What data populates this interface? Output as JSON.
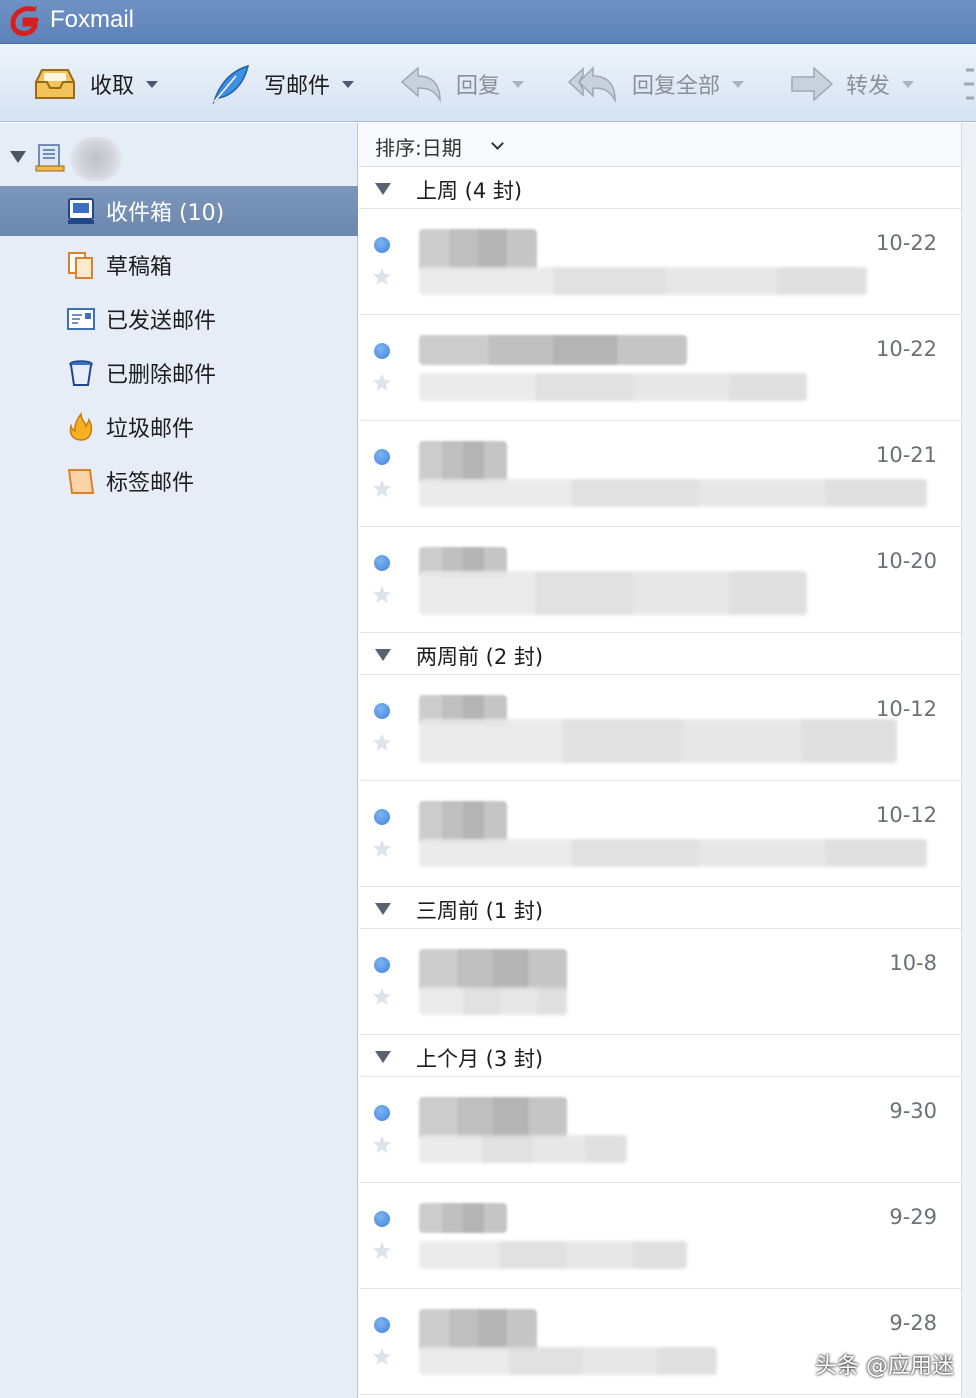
{
  "window": {
    "title": "Foxmail"
  },
  "toolbar": {
    "receive_label": "收取",
    "compose_label": "写邮件",
    "reply_label": "回复",
    "reply_all_label": "回复全部",
    "forward_label": "转发"
  },
  "sidebar": {
    "folders": [
      {
        "label": "收件箱 (10)",
        "icon": "inbox-icon",
        "selected": true
      },
      {
        "label": "草稿箱",
        "icon": "drafts-icon",
        "selected": false
      },
      {
        "label": "已发送邮件",
        "icon": "sent-icon",
        "selected": false
      },
      {
        "label": "已删除邮件",
        "icon": "trash-icon",
        "selected": false
      },
      {
        "label": "垃圾邮件",
        "icon": "junk-icon",
        "selected": false
      },
      {
        "label": "标签邮件",
        "icon": "tag-icon",
        "selected": false
      }
    ]
  },
  "list": {
    "sort_label": "排序:日期",
    "groups": [
      {
        "label": "上周 (4 封)"
      },
      {
        "label": "两周前 (2 封)"
      },
      {
        "label": "三周前 (1 封)"
      },
      {
        "label": "上个月 (3 封)"
      }
    ],
    "mails": [
      {
        "date": "10-22"
      },
      {
        "date": "10-22"
      },
      {
        "date": "10-21"
      },
      {
        "date": "10-20"
      },
      {
        "date": "10-12"
      },
      {
        "date": "10-12"
      },
      {
        "date": "10-8"
      },
      {
        "date": "9-30"
      },
      {
        "date": "9-29"
      },
      {
        "date": "9-28"
      }
    ]
  },
  "watermark": "头条 @应用迷",
  "colors": {
    "titlebar": "#6385bb",
    "selected_folder": "#7490b6",
    "unread_dot": "#4a8fe3",
    "sidebar_bg": "#e6edf6"
  }
}
